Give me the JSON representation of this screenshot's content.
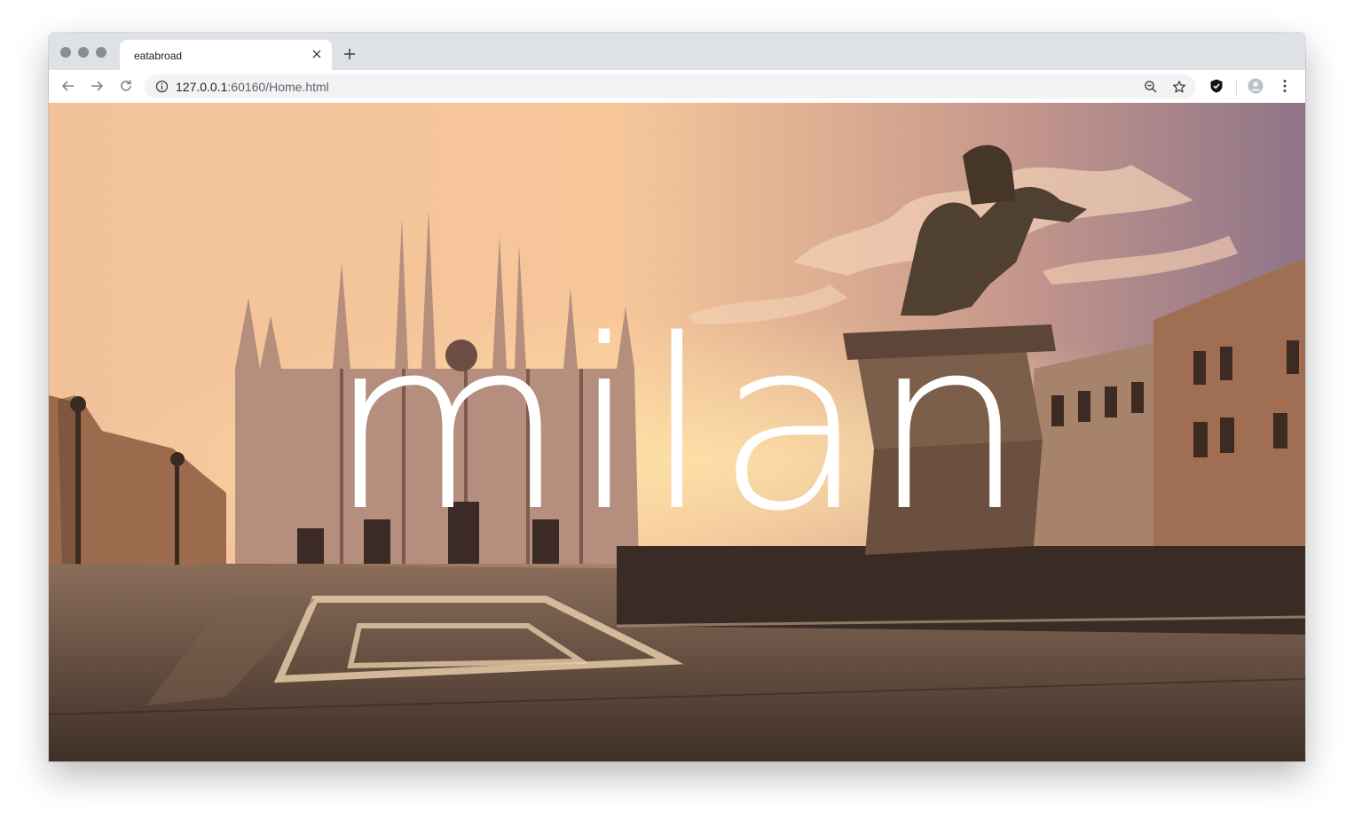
{
  "browser": {
    "tab_title": "eatabroad",
    "url_host": "127.0.0.1",
    "url_rest": ":60160/Home.html",
    "icons": [
      "back-icon",
      "forward-icon",
      "reload-icon",
      "info-icon",
      "zoom-icon",
      "star-icon",
      "shield-icon",
      "profile-icon",
      "menu-icon",
      "close-icon",
      "plus-icon"
    ]
  },
  "hero": {
    "title": "milan"
  },
  "colors": {
    "tabstrip": "#dee1e6",
    "omnibox": "#f1f3f4",
    "sky_warm": "#f3c48f",
    "title_text": "#ffffff"
  }
}
